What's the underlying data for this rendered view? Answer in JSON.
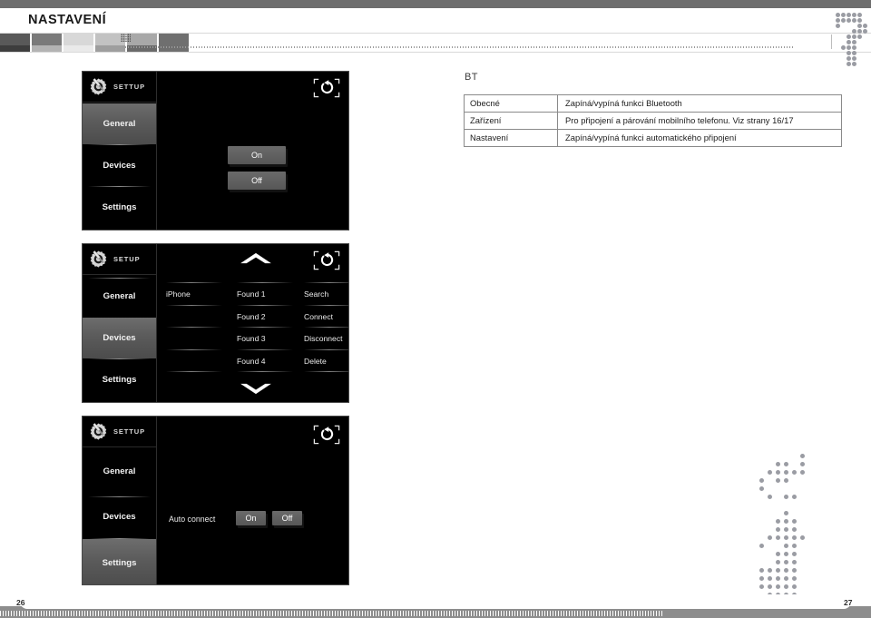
{
  "document": {
    "title": "NASTAVENÍ",
    "page_left": "26",
    "page_right": "27"
  },
  "colors": {
    "top_bar": "#6e6e6e",
    "screen_bg": "#000000",
    "screen_border": "#4a4a4a",
    "button": "#5f5f5f",
    "selected_tab": "#5b5b5b",
    "table_border": "#8a8a8a",
    "dots": "#9a9ca3"
  },
  "swatch_strip": [
    {
      "top": "#595959",
      "bottom": "#3d3d3d"
    },
    {
      "top": "#7a7a7a",
      "bottom": "#b3b3b3"
    },
    {
      "top": "#d8d8d8",
      "bottom": "#eaeaea"
    },
    {
      "top": "#c2c2c2",
      "bottom": "#9e9e9e"
    },
    {
      "top": "#a8a8a8",
      "bottom": "#6a6a6a"
    },
    {
      "top": "#6f6f6f",
      "bottom": "#6f6f6f"
    }
  ],
  "bt_section": {
    "label": "BT",
    "table": {
      "rows": [
        {
          "key": "Obecné",
          "value": "Zapíná/vypíná funkci Bluetooth"
        },
        {
          "key": "Zařízení",
          "value": "Pro připojení a párování mobilního telefonu. Viz strany 16/17"
        },
        {
          "key": "Nastavení",
          "value": "Zapíná/vypíná funkci automatického připojení"
        }
      ]
    }
  },
  "screens": [
    {
      "id": "general",
      "header": {
        "icon": "gear-screwdriver-icon",
        "label": "SETTUP"
      },
      "return_icon": "return-arrow-icon",
      "sidebar": [
        {
          "label": "General",
          "selected": true
        },
        {
          "label": "Devices",
          "selected": false
        },
        {
          "label": "Settings",
          "selected": false
        }
      ],
      "buttons": [
        {
          "label": "On"
        },
        {
          "label": "Off"
        }
      ]
    },
    {
      "id": "devices",
      "header": {
        "icon": "gear-screwdriver-icon",
        "label": "SETUP"
      },
      "return_icon": "return-arrow-icon",
      "scroll_up_icon": "chevron-up-icon",
      "scroll_down_icon": "chevron-down-icon",
      "sidebar": [
        {
          "label": "General",
          "selected": false
        },
        {
          "label": "Devices",
          "selected": true
        },
        {
          "label": "Settings",
          "selected": false
        }
      ],
      "paired_list": [
        "iPhone",
        "",
        "",
        ""
      ],
      "found_list": [
        "Found 1",
        "Found 2",
        "Found 3",
        "Found 4"
      ],
      "action_list": [
        "Search",
        "Connect",
        "Disconnect",
        "Delete"
      ]
    },
    {
      "id": "settings",
      "header": {
        "icon": "gear-screwdriver-icon",
        "label": "SETTUP"
      },
      "return_icon": "return-arrow-icon",
      "sidebar": [
        {
          "label": "General",
          "selected": false
        },
        {
          "label": "Devices",
          "selected": false
        },
        {
          "label": "Settings",
          "selected": true
        }
      ],
      "setting_row": {
        "label": "Auto connect",
        "buttons": [
          {
            "label": "On"
          },
          {
            "label": "Off"
          }
        ]
      }
    }
  ]
}
